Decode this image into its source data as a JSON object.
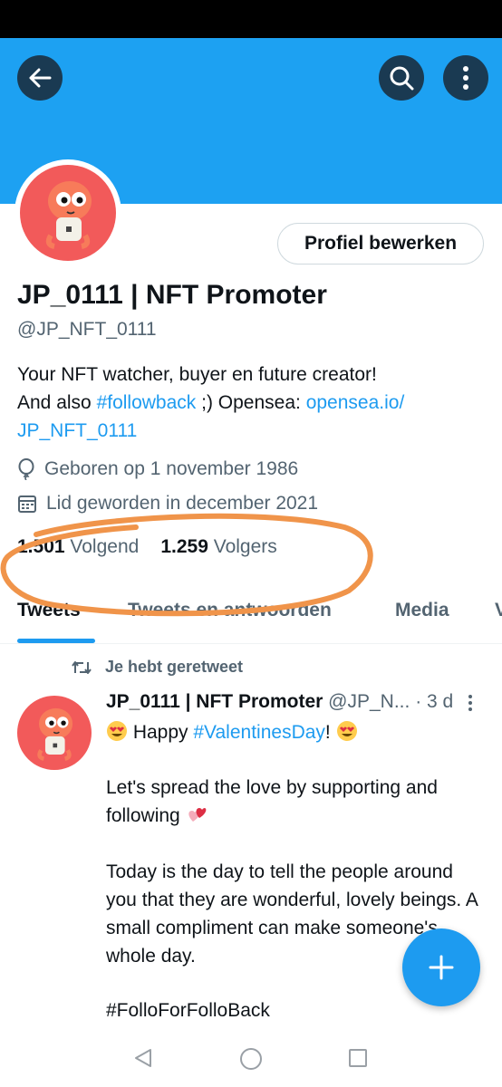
{
  "header": {
    "back_icon": "arrow-left-icon",
    "search_icon": "search-icon",
    "more_icon": "more-vertical-icon",
    "banner_color": "#1da1f2"
  },
  "profile": {
    "edit_button": "Profiel bewerken",
    "display_name": "JP_0111 | NFT Promoter",
    "handle": "@JP_NFT_0111",
    "bio_line1": "Your NFT watcher, buyer en future creator!",
    "bio_line2_prefix": "And also ",
    "bio_hashtag": "#followback",
    "bio_line2_mid": " ;)  Opensea: ",
    "bio_link_part1": "opensea.io/",
    "bio_link_part2": "JP_NFT_0111",
    "birthday": "Geboren op 1 november 1986",
    "joined": "Lid geworden in december 2021",
    "following_count": "1.501",
    "following_label": "Volgend",
    "followers_count": "1.259",
    "followers_label": "Volgers"
  },
  "tabs": [
    {
      "label": "Tweets",
      "active": true
    },
    {
      "label": "Tweets en antwoorden",
      "active": false
    },
    {
      "label": "Media",
      "active": false
    },
    {
      "label": "V",
      "active": false
    }
  ],
  "tweet": {
    "retweet_label": "Je hebt geretweet",
    "author_name": "JP_0111 | NFT Promoter",
    "author_handle": "@JP_N...",
    "dot": "·",
    "time": "3 d",
    "line1_text": " Happy ",
    "line1_hashtag": "#ValentinesDay",
    "line1_end": "! ",
    "para2": "Let's spread the love by supporting and following",
    "para3": "Today is the day to tell the people around you that they are wonderful, lovely beings. A small compliment can make someone's whole day.",
    "hashtag_last": "#FolloForFolloBack"
  },
  "fab": {
    "icon": "plus-icon"
  },
  "nav": {
    "back_icon": "triangle-back-icon",
    "home_icon": "circle-home-icon",
    "recents_icon": "square-recents-icon"
  },
  "colors": {
    "accent": "#1d9bf0",
    "annotation": "#f0944a",
    "avatar_bg": "#f25a5a"
  }
}
